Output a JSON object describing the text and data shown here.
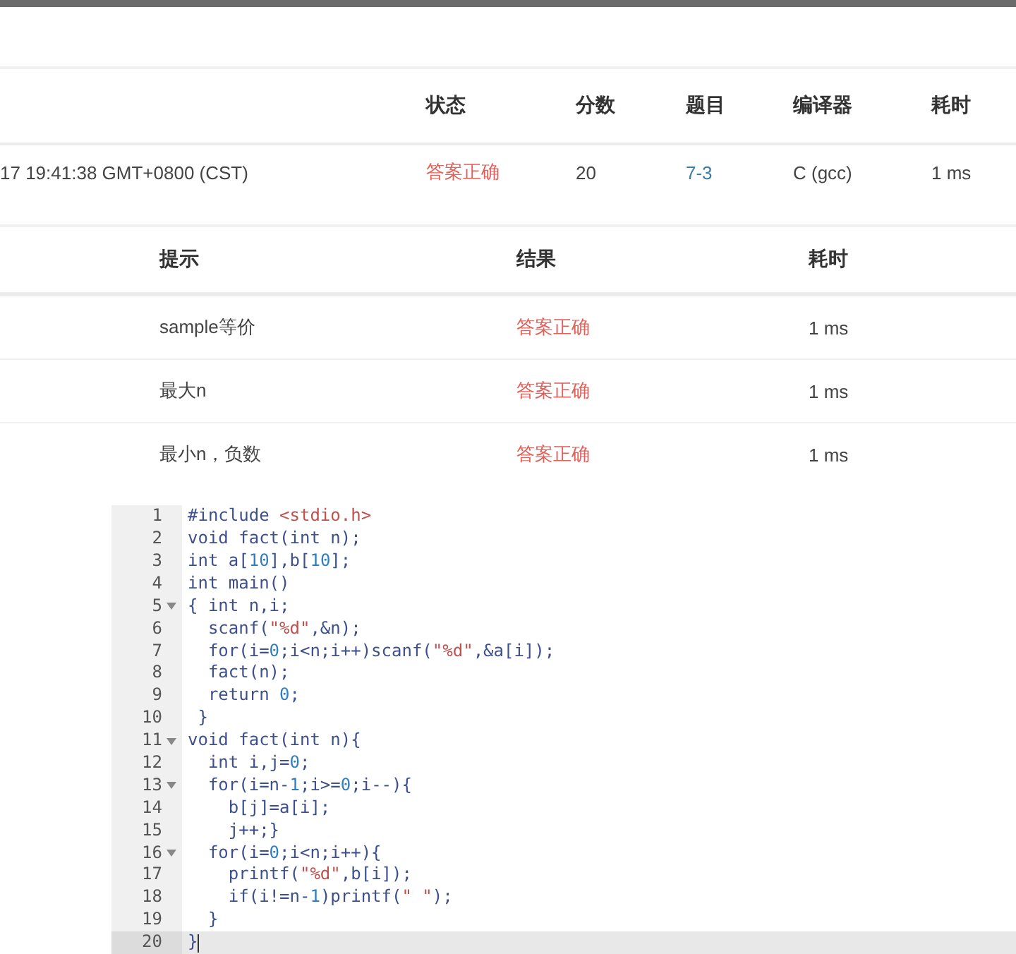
{
  "submission_table": {
    "columns": [
      "",
      "状态",
      "分数",
      "题目",
      "编译器",
      "耗时"
    ],
    "rows": [
      {
        "time": "17 19:41:38 GMT+0800 (CST)",
        "status": "答案正确",
        "score": "20",
        "problem": "7-3",
        "compiler": "C (gcc)",
        "duration": "1 ms"
      }
    ]
  },
  "case_table": {
    "columns": [
      "提示",
      "结果",
      "耗时"
    ],
    "rows": [
      {
        "hint": "sample等价",
        "result": "答案正确",
        "duration": "1 ms"
      },
      {
        "hint": "最大n",
        "result": "答案正确",
        "duration": "1 ms"
      },
      {
        "hint": "最小n，负数",
        "result": "答案正确",
        "duration": "1 ms"
      }
    ]
  },
  "code_editor": {
    "lines": [
      {
        "number": "1",
        "foldable": false,
        "active": false,
        "segments": [
          {
            "text": "#include ",
            "kind": "code"
          },
          {
            "text": "<stdio.h>",
            "kind": "string"
          }
        ]
      },
      {
        "number": "2",
        "foldable": false,
        "active": false,
        "segments": [
          {
            "text": "void fact(int n);",
            "kind": "code"
          }
        ]
      },
      {
        "number": "3",
        "foldable": false,
        "active": false,
        "segments": [
          {
            "text": "int a[",
            "kind": "code"
          },
          {
            "text": "10",
            "kind": "number"
          },
          {
            "text": "],b[",
            "kind": "code"
          },
          {
            "text": "10",
            "kind": "number"
          },
          {
            "text": "];",
            "kind": "code"
          }
        ]
      },
      {
        "number": "4",
        "foldable": false,
        "active": false,
        "segments": [
          {
            "text": "int main()",
            "kind": "code"
          }
        ]
      },
      {
        "number": "5",
        "foldable": true,
        "active": false,
        "segments": [
          {
            "text": "{ int n,i;",
            "kind": "code"
          }
        ]
      },
      {
        "number": "6",
        "foldable": false,
        "active": false,
        "segments": [
          {
            "text": "  scanf(",
            "kind": "code"
          },
          {
            "text": "\"%d\"",
            "kind": "string"
          },
          {
            "text": ",&n);",
            "kind": "code"
          }
        ]
      },
      {
        "number": "7",
        "foldable": false,
        "active": false,
        "segments": [
          {
            "text": "  for(i=",
            "kind": "code"
          },
          {
            "text": "0",
            "kind": "number"
          },
          {
            "text": ";i<n;i++)scanf(",
            "kind": "code"
          },
          {
            "text": "\"%d\"",
            "kind": "string"
          },
          {
            "text": ",&a[i]);",
            "kind": "code"
          }
        ]
      },
      {
        "number": "8",
        "foldable": false,
        "active": false,
        "segments": [
          {
            "text": "  fact(n);",
            "kind": "code"
          }
        ]
      },
      {
        "number": "9",
        "foldable": false,
        "active": false,
        "segments": [
          {
            "text": "  return ",
            "kind": "code"
          },
          {
            "text": "0",
            "kind": "number"
          },
          {
            "text": ";",
            "kind": "code"
          }
        ]
      },
      {
        "number": "10",
        "foldable": false,
        "active": false,
        "segments": [
          {
            "text": " }",
            "kind": "code"
          }
        ]
      },
      {
        "number": "11",
        "foldable": true,
        "active": false,
        "segments": [
          {
            "text": "void fact(int n){",
            "kind": "code"
          }
        ]
      },
      {
        "number": "12",
        "foldable": false,
        "active": false,
        "segments": [
          {
            "text": "  int i,j=",
            "kind": "code"
          },
          {
            "text": "0",
            "kind": "number"
          },
          {
            "text": ";",
            "kind": "code"
          }
        ]
      },
      {
        "number": "13",
        "foldable": true,
        "active": false,
        "segments": [
          {
            "text": "  for(i=n-",
            "kind": "code"
          },
          {
            "text": "1",
            "kind": "number"
          },
          {
            "text": ";i>=",
            "kind": "code"
          },
          {
            "text": "0",
            "kind": "number"
          },
          {
            "text": ";i--){",
            "kind": "code"
          }
        ]
      },
      {
        "number": "14",
        "foldable": false,
        "active": false,
        "segments": [
          {
            "text": "    b[j]=a[i];",
            "kind": "code"
          }
        ]
      },
      {
        "number": "15",
        "foldable": false,
        "active": false,
        "segments": [
          {
            "text": "    j++;}",
            "kind": "code"
          }
        ]
      },
      {
        "number": "16",
        "foldable": true,
        "active": false,
        "segments": [
          {
            "text": "  for(i=",
            "kind": "code"
          },
          {
            "text": "0",
            "kind": "number"
          },
          {
            "text": ";i<n;i++){",
            "kind": "code"
          }
        ]
      },
      {
        "number": "17",
        "foldable": false,
        "active": false,
        "segments": [
          {
            "text": "    printf(",
            "kind": "code"
          },
          {
            "text": "\"%d\"",
            "kind": "string"
          },
          {
            "text": ",b[i]);",
            "kind": "code"
          }
        ]
      },
      {
        "number": "18",
        "foldable": false,
        "active": false,
        "segments": [
          {
            "text": "    if(i!=n-",
            "kind": "code"
          },
          {
            "text": "1",
            "kind": "number"
          },
          {
            "text": ")printf(",
            "kind": "code"
          },
          {
            "text": "\" \"",
            "kind": "string"
          },
          {
            "text": ");",
            "kind": "code"
          }
        ]
      },
      {
        "number": "19",
        "foldable": false,
        "active": false,
        "segments": [
          {
            "text": "  }",
            "kind": "code"
          }
        ]
      },
      {
        "number": "20",
        "foldable": false,
        "active": true,
        "segments": [
          {
            "text": "}",
            "kind": "code"
          }
        ]
      }
    ]
  }
}
